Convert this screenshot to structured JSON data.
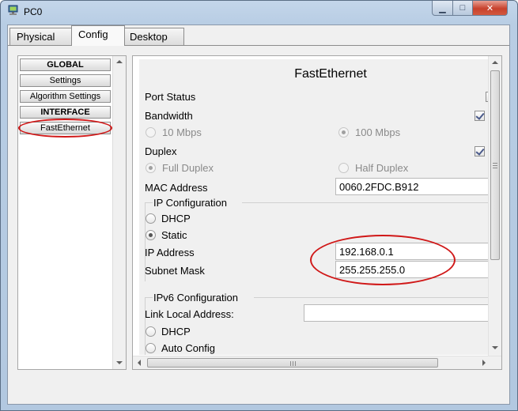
{
  "window": {
    "title": "PC0",
    "minimize_glyph": "▁",
    "maximize_glyph": "□",
    "close_glyph": "✕",
    "app_icon": "pc-icon"
  },
  "tabs": [
    {
      "label": "Physical",
      "active": false
    },
    {
      "label": "Config",
      "active": true
    },
    {
      "label": "Desktop",
      "active": false
    }
  ],
  "sidebar": {
    "items": [
      {
        "label": "GLOBAL",
        "header": true
      },
      {
        "label": "Settings",
        "header": false
      },
      {
        "label": "Algorithm Settings",
        "header": false
      },
      {
        "label": "INTERFACE",
        "header": true
      },
      {
        "label": "FastEthernet",
        "header": false,
        "highlighted": true
      }
    ]
  },
  "interface": {
    "title": "FastEthernet",
    "port_status": {
      "label": "Port Status"
    },
    "bandwidth": {
      "label": "Bandwidth",
      "auto_checked": true,
      "options": [
        {
          "label": "10 Mbps",
          "selected": false,
          "enabled": false
        },
        {
          "label": "100 Mbps",
          "selected": true,
          "enabled": false
        }
      ]
    },
    "duplex": {
      "label": "Duplex",
      "auto_checked": true,
      "options": [
        {
          "label": "Full Duplex",
          "selected": true,
          "enabled": false
        },
        {
          "label": "Half Duplex",
          "selected": false,
          "enabled": false
        }
      ]
    },
    "mac": {
      "label": "MAC Address",
      "value": "0060.2FDC.B912"
    },
    "ipv4": {
      "group_label": "IP Configuration",
      "dhcp_label": "DHCP",
      "static_label": "Static",
      "mode": "static",
      "ip_label": "IP Address",
      "ip_value": "192.168.0.1",
      "mask_label": "Subnet Mask",
      "mask_value": "255.255.255.0"
    },
    "ipv6": {
      "group_label": "IPv6 Configuration",
      "link_local_label": "Link Local Address:",
      "link_local_value": "",
      "dhcp_label": "DHCP",
      "auto_label": "Auto Config"
    }
  },
  "colors": {
    "annotation": "#d01818"
  }
}
